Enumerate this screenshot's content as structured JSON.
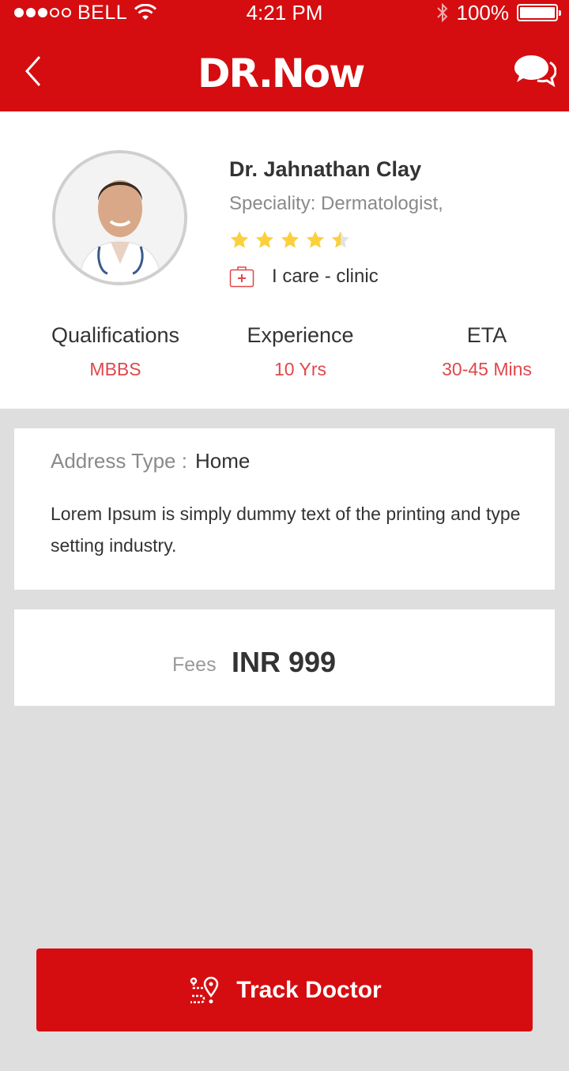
{
  "status_bar": {
    "carrier": "BELL",
    "time": "4:21 PM",
    "battery": "100%",
    "battery_level": 1.0,
    "signal_bars_filled": 3,
    "signal_bars_total": 5
  },
  "header": {
    "logo_text": "DR.Now",
    "back_icon": "chevron-left-icon",
    "chat_icon": "chat-bubbles-icon",
    "brand_color": "#d50d10"
  },
  "doctor": {
    "name": "Dr. Jahnathan Clay",
    "speciality": "Speciality: Dermatologist,",
    "rating": 4.5,
    "rating_max": 5,
    "clinic": "I care - clinic",
    "clinic_icon": "first-aid-kit-icon"
  },
  "stats": [
    {
      "label": "Qualifications",
      "value": "MBBS"
    },
    {
      "label": "Experience",
      "value": "10 Yrs"
    },
    {
      "label": "ETA",
      "value": "30-45 Mins"
    }
  ],
  "address": {
    "type_label": "Address Type :",
    "type_value": "Home",
    "text": "Lorem Ipsum is simply dummy text of the printing and type setting industry."
  },
  "fees": {
    "label": "Fees",
    "value": "INR 999"
  },
  "track_button": {
    "label": "Track Doctor",
    "icon": "route-pin-icon"
  },
  "colors": {
    "accent": "#d50d10",
    "stat_value": "#e0474c",
    "star": "#fcd03a",
    "star_empty": "#e2e2e2"
  }
}
